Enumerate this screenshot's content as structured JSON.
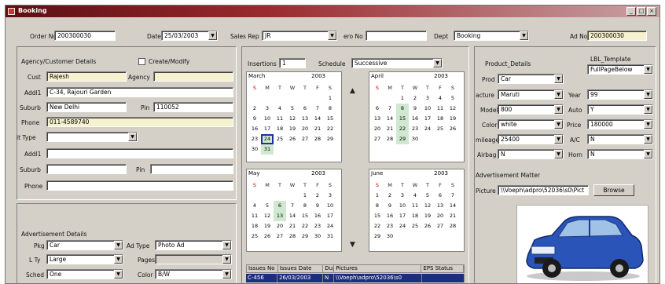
{
  "window": {
    "title": "Booking"
  },
  "header": {
    "order_no_label": "Order No",
    "order_no": "200300030",
    "date_label": "Date",
    "date": "25/03/2003",
    "sales_rep_label": "Sales Rep",
    "sales_rep": "JR",
    "ero_no_label": "ero No",
    "ero_no": "",
    "dept_label": "Dept",
    "dept": "Booking",
    "ad_no_label": "Ad No",
    "ad_no": "200300030"
  },
  "agency": {
    "section": "Agency/Customer Details",
    "create_modify": "Create/Modify",
    "cust_label": "Cust",
    "cust": "Rajesh",
    "agency_label": "Agency",
    "agency": "",
    "addr1_label": "Addl1",
    "addr1": "C-34, Rajouri Garden",
    "suburb_label": "Suburb",
    "suburb": "New Delhi",
    "pin_label": "Pin",
    "pin": "110052",
    "phone_label": "Phone",
    "phone": "011-4589740",
    "type_label": "it Type",
    "type": "",
    "addr1b_label": "Addl1",
    "addr1b": "",
    "suburb2_label": "Suburb",
    "suburb2": "",
    "pin2_label": "Pin",
    "pin2": "",
    "phone2_label": "Phone",
    "phone2": ""
  },
  "ad_details": {
    "section": "Advertisement Details",
    "pkg_label": "Pkg",
    "pkg": "Car",
    "adtype_label": "Ad Type",
    "adtype": "Photo Ad",
    "size_label": "L Ty",
    "size": "Large",
    "pages_label": "Pages",
    "pages": "",
    "sched_label": "Sched",
    "sched": "One",
    "color_label": "Color",
    "color": "B/W"
  },
  "schedule": {
    "insertions_label": "Insertions",
    "insertions": "1",
    "schedule_label": "Schedule",
    "schedule": "Successive",
    "day_headers": [
      "S",
      "M",
      "T",
      "W",
      "T",
      "F",
      "S"
    ],
    "months": [
      {
        "name": "March",
        "year": "2003",
        "weeks": [
          [
            "",
            "",
            "",
            "",
            "",
            "",
            "1"
          ],
          [
            "2",
            "3",
            "4",
            "5",
            "6",
            "7",
            "8"
          ],
          [
            "9",
            "10",
            "11",
            "12",
            "13",
            "14",
            "15"
          ],
          [
            "16",
            "17",
            "18",
            "19",
            "20",
            "21",
            "22"
          ],
          [
            "23",
            "24",
            "25",
            "26",
            "27",
            "28",
            "29"
          ],
          [
            "30",
            "31",
            "",
            "",
            "",
            "",
            ""
          ]
        ]
      },
      {
        "name": "April",
        "year": "2003",
        "weeks": [
          [
            "",
            "",
            "1",
            "2",
            "3",
            "4",
            "5"
          ],
          [
            "6",
            "7",
            "8",
            "9",
            "10",
            "11",
            "12"
          ],
          [
            "13",
            "14",
            "15",
            "16",
            "17",
            "18",
            "19"
          ],
          [
            "20",
            "21",
            "22",
            "23",
            "24",
            "25",
            "26"
          ],
          [
            "27",
            "28",
            "29",
            "30",
            "",
            "",
            ""
          ]
        ]
      },
      {
        "name": "May",
        "year": "2003",
        "weeks": [
          [
            "",
            "",
            "",
            "",
            "1",
            "2",
            "3"
          ],
          [
            "4",
            "5",
            "6",
            "7",
            "8",
            "9",
            "10"
          ],
          [
            "11",
            "12",
            "13",
            "14",
            "15",
            "16",
            "17"
          ],
          [
            "18",
            "19",
            "20",
            "21",
            "22",
            "23",
            "24"
          ],
          [
            "25",
            "26",
            "27",
            "28",
            "29",
            "30",
            "31"
          ]
        ]
      },
      {
        "name": "June",
        "year": "2003",
        "weeks": [
          [
            "1",
            "2",
            "3",
            "4",
            "5",
            "6",
            "7"
          ],
          [
            "8",
            "9",
            "10",
            "11",
            "12",
            "13",
            "14"
          ],
          [
            "15",
            "16",
            "17",
            "18",
            "19",
            "20",
            "21"
          ],
          [
            "22",
            "23",
            "24",
            "25",
            "26",
            "27",
            "28"
          ],
          [
            "29",
            "30",
            "",
            "",
            "",
            "",
            ""
          ]
        ]
      }
    ],
    "table_headers": [
      "Issues No",
      "Issues Date",
      "Dup",
      "Pictures",
      "EPS Status"
    ],
    "table_row": [
      "C-456",
      "26/03/2003",
      "N",
      "\\\\Voeph\\adpro\\52036\\s0",
      ""
    ]
  },
  "product": {
    "section": "Product_Details",
    "template_label": "LBL_Template",
    "template": "FullPageBelow",
    "prod_label": "Prod",
    "prod": "Car",
    "make_label": "acture",
    "make": "Maruti",
    "model_label": "Model",
    "model": "800",
    "color_label": "Color",
    "color": "white",
    "mileage_label": "mileage",
    "mileage": "25400",
    "airbag_label": "Airbag",
    "airbag": "N",
    "year_label": "Year",
    "year": "99",
    "auto_label": "Auto",
    "auto": "Y",
    "price_label": "Price",
    "price": "180000",
    "ac_label": "A/C",
    "ac": "N",
    "horn_label": "Horn",
    "horn": "N"
  },
  "ad_matter": {
    "section": "Advertisement Matter",
    "picture_label": "Picture",
    "picture": "\\\\Voeph\\adpro\\52036\\s0\\Pict",
    "browse": "Browse"
  }
}
